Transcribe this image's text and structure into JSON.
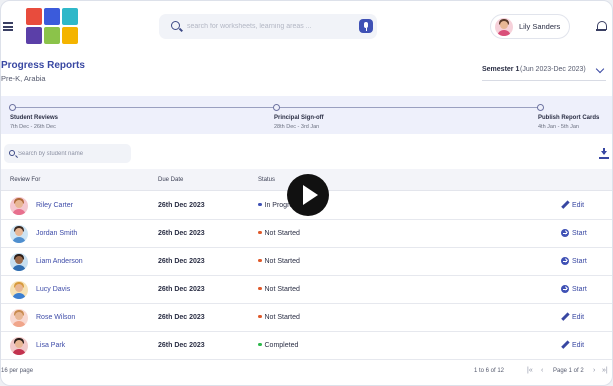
{
  "search": {
    "placeholder": "search for worksheets, learning areas ..."
  },
  "user": {
    "name": "Lily Sanders"
  },
  "logo": {
    "tile_colors": [
      "#e84c3d",
      "#3b5bdb",
      "#2fb8c9",
      "#5b3fa8",
      "#8bc34a",
      "#f4b400"
    ]
  },
  "page": {
    "title": "Progress Reports",
    "subtitle": "Pre-K, Arabia"
  },
  "semester": {
    "label": "Semester 1",
    "range": "(Jun 2023-Dec 2023)"
  },
  "timeline": [
    {
      "title": "Student Reviews",
      "dates": "7th Dec - 26th Dec"
    },
    {
      "title": "Principal Sign-off",
      "dates": "28th Dec - 3rd Jan"
    },
    {
      "title": "Publish Report Cards",
      "dates": "4th Jan - 5th Jan"
    }
  ],
  "student_search": {
    "placeholder": "Search by student name"
  },
  "table": {
    "headers": {
      "review_for": "Review For",
      "due_date": "Due Date",
      "status": "Status"
    },
    "rows": [
      {
        "name": "Riley Carter",
        "due": "26th Dec 2023",
        "status": "In Progress",
        "status_color": "#3f51b5",
        "action": "Edit",
        "action_icon": "pencil-icon"
      },
      {
        "name": "Jordan Smith",
        "due": "26th Dec 2023",
        "status": "Not Started",
        "status_color": "#e0592a",
        "action": "Start",
        "action_icon": "arrow-right-circle-icon"
      },
      {
        "name": "Liam Anderson",
        "due": "26th Dec 2023",
        "status": "Not Started",
        "status_color": "#e0592a",
        "action": "Start",
        "action_icon": "arrow-right-circle-icon"
      },
      {
        "name": "Lucy Davis",
        "due": "26th Dec 2023",
        "status": "Not Started",
        "status_color": "#e0592a",
        "action": "Start",
        "action_icon": "arrow-right-circle-icon"
      },
      {
        "name": "Rose Wilson",
        "due": "26th Dec 2023",
        "status": "Not Started",
        "status_color": "#e0592a",
        "action": "Edit",
        "action_icon": "pencil-icon"
      },
      {
        "name": "Lisa Park",
        "due": "26th Dec 2023",
        "status": "Completed",
        "status_color": "#2db84b",
        "action": "Edit",
        "action_icon": "pencil-icon"
      }
    ]
  },
  "footer": {
    "per_page": "16 per page",
    "range": "1 to 6 of 12",
    "page_of": "Page 1 of 2",
    "first": "|«",
    "prev": "‹",
    "next": "›",
    "last": "»|"
  }
}
